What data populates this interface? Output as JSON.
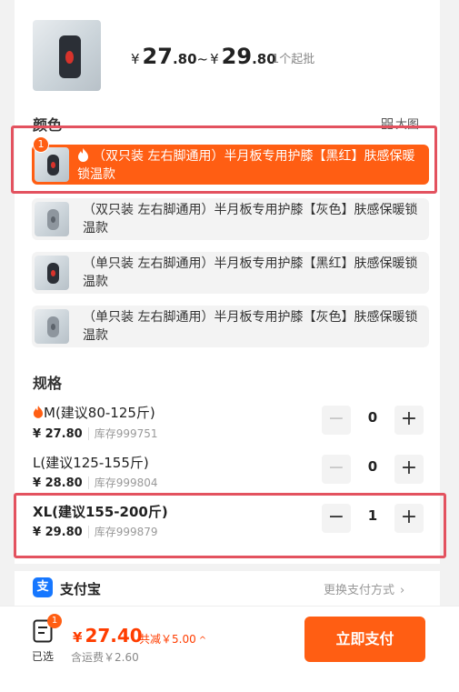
{
  "product": {
    "price_from": "27",
    "price_from_dec": ".80",
    "price_sep": "~",
    "price_to": "29",
    "price_to_dec": ".80",
    "currency": "¥",
    "moq": "1个起批"
  },
  "color_section": {
    "title": "颜色",
    "view_toggle": "大图",
    "options": [
      {
        "label": "（双只装 左右脚通用）半月板专用护膝【黑红】肤感保暖锁温款",
        "selected": true,
        "badge": "1"
      },
      {
        "label": "（双只装 左右脚通用）半月板专用护膝【灰色】肤感保暖锁温款",
        "selected": false
      },
      {
        "label": "（单只装 左右脚通用）半月板专用护膝【黑红】肤感保暖锁温款",
        "selected": false
      },
      {
        "label": "（单只装 左右脚通用）半月板专用护膝【灰色】肤感保暖锁温款",
        "selected": false
      }
    ]
  },
  "spec_section": {
    "title": "规格",
    "items": [
      {
        "name": "M(建议80-125斤)",
        "price": "¥ 27.80",
        "stock": "库存999751",
        "qty": "0",
        "hot": true
      },
      {
        "name": "L(建议125-155斤)",
        "price": "¥ 28.80",
        "stock": "库存999804",
        "qty": "0",
        "hot": false
      },
      {
        "name": "XL(建议155-200斤)",
        "price": "¥ 29.80",
        "stock": "库存999879",
        "qty": "1",
        "hot": false
      }
    ],
    "minus": "−",
    "plus": "+"
  },
  "payment": {
    "method": "支付宝",
    "change": "更换支付方式"
  },
  "bottom_bar": {
    "cart_badge": "1",
    "selected_label": "已选",
    "total_symbol": "¥",
    "total": "27.40",
    "saved": "共减￥5.00",
    "shipping": "含运费￥2.60",
    "pay_button": "立即支付"
  },
  "colors": {
    "accent": "#ff5e13",
    "price_red": "#ff3d00",
    "highlight": "#e3525f",
    "alipay_blue": "#1677ff"
  }
}
